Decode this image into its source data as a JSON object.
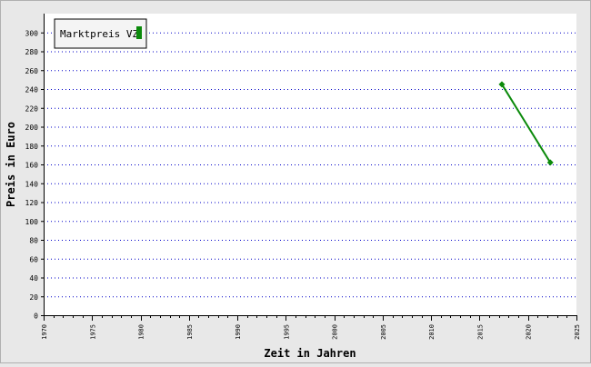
{
  "chart_data": {
    "type": "line",
    "xlabel": "Zeit in Jahren",
    "ylabel": "Preis in Euro",
    "xlim": [
      1970,
      2025
    ],
    "ylim": [
      0,
      320
    ],
    "x_ticks": [
      "1970",
      "1975",
      "1980",
      "1985",
      "1990",
      "1995",
      "2000",
      "2005",
      "2010",
      "2015",
      "2020",
      "2025"
    ],
    "x_tick_values": [
      1970,
      1975,
      1980,
      1985,
      1990,
      1995,
      2000,
      2005,
      2010,
      2015,
      2020,
      2025
    ],
    "y_ticks": [
      "0",
      "20",
      "40",
      "60",
      "80",
      "100",
      "120",
      "140",
      "160",
      "180",
      "200",
      "220",
      "240",
      "260",
      "280",
      "300"
    ],
    "y_tick_values": [
      0,
      20,
      40,
      60,
      80,
      100,
      120,
      140,
      160,
      180,
      200,
      220,
      240,
      260,
      280,
      300
    ],
    "grid": true,
    "legend_position": "top-left",
    "series": [
      {
        "name": "Marktpreis VZ",
        "color": "#0b8a0b",
        "points": [
          {
            "x": 2017.3,
            "y": 245
          },
          {
            "x": 2022.3,
            "y": 162
          }
        ]
      }
    ]
  },
  "colors": {
    "background": "#e8e8e8",
    "plot_area": "#ffffff",
    "grid": "#0000c8"
  }
}
